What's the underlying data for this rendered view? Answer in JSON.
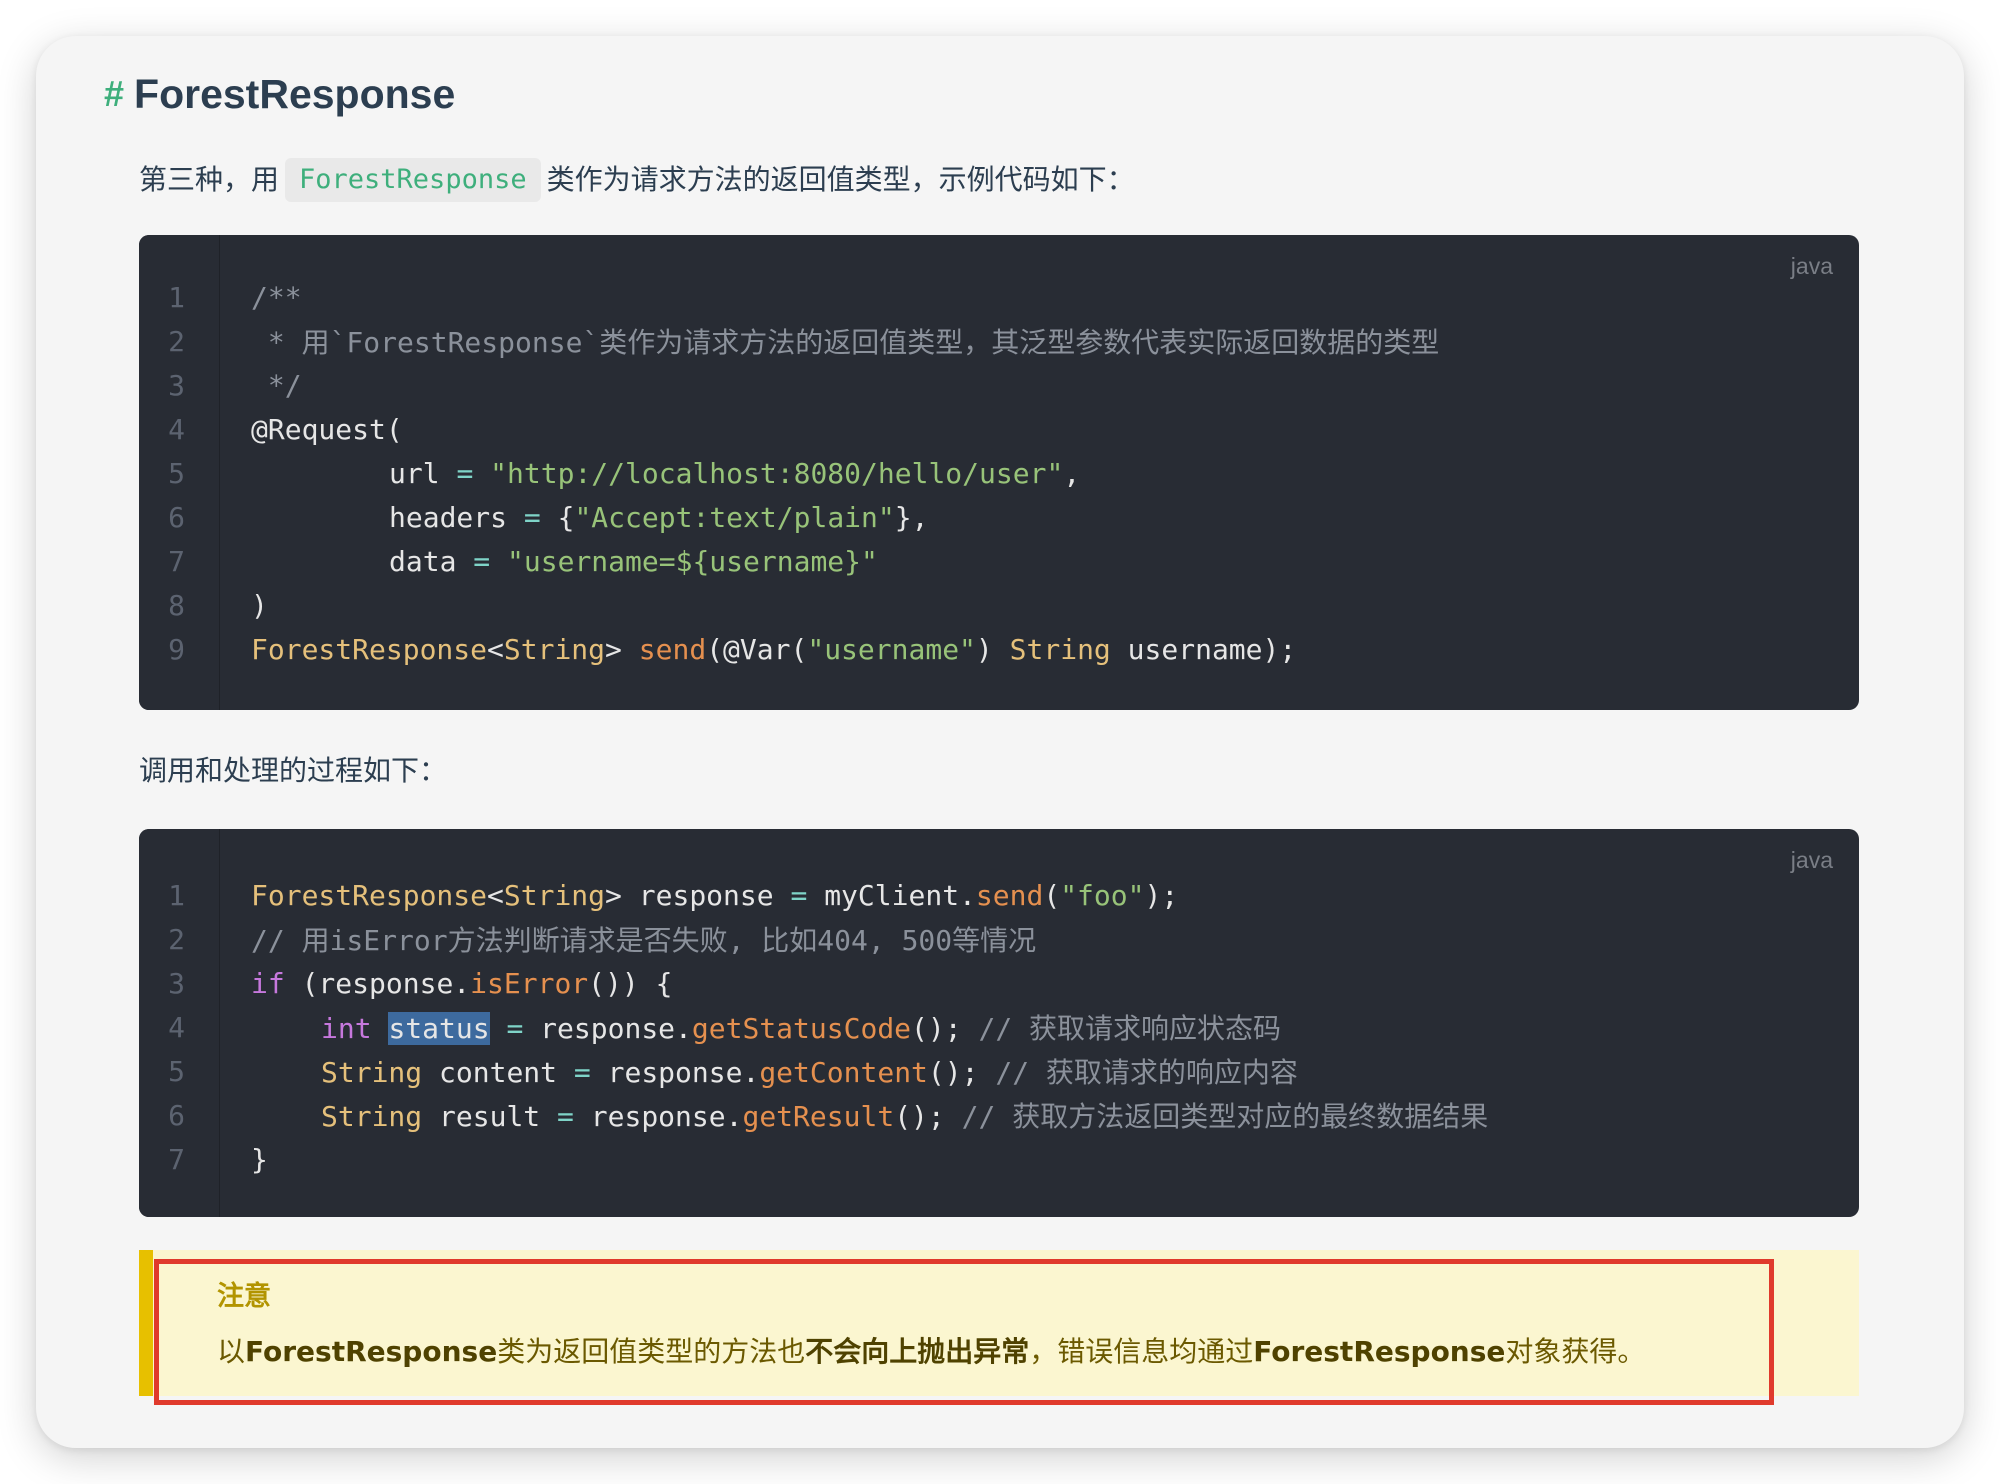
{
  "heading": {
    "hash": "#",
    "title": "ForestResponse"
  },
  "intro": {
    "prefix": "第三种，用",
    "code": "ForestResponse",
    "suffix": "类作为请求方法的返回值类型，示例代码如下："
  },
  "code1": {
    "lang": "java",
    "line_numbers": [
      "1",
      "2",
      "3",
      "4",
      "5",
      "6",
      "7",
      "8",
      "9"
    ],
    "tokens": [
      "/**",
      " * 用`ForestResponse`类作为请求方法的返回值类型，其泛型参数代表实际返回数据的类型",
      " */",
      "@Request(",
      "url",
      "=",
      "\"http://localhost:8080/hello/user\"",
      ",",
      "headers",
      "=",
      "{",
      "\"Accept:text/plain\"",
      "},",
      "data",
      "=",
      "\"username=${username}\"",
      ")",
      "ForestResponse",
      "<",
      "String",
      ">",
      "send",
      "(@Var(",
      "\"username\"",
      ")",
      "String",
      "username);"
    ]
  },
  "middle": {
    "text": "调用和处理的过程如下："
  },
  "code2": {
    "lang": "java",
    "line_numbers": [
      "1",
      "2",
      "3",
      "4",
      "5",
      "6",
      "7"
    ],
    "tokens": [
      "ForestResponse",
      "<",
      "String",
      ">",
      "response",
      "=",
      "myClient.",
      "send",
      "(",
      "\"foo\"",
      ");",
      "// 用isError方法判断请求是否失败, 比如404, 500等情况",
      "if",
      "(response.",
      "isError",
      "()) {",
      "int",
      "status",
      "=",
      "response.",
      "getStatusCode",
      "();",
      "// 获取请求响应状态码",
      "String",
      "content",
      "=",
      "response.",
      "getContent",
      "();",
      "// 获取请求的响应内容",
      "String",
      "result",
      "=",
      "response.",
      "getResult",
      "();",
      "// 获取方法返回类型对应的最终数据结果",
      "}"
    ]
  },
  "notice": {
    "title": "注意",
    "parts": [
      "以",
      "ForestResponse",
      "类为返回值类型的方法也",
      "不会向上抛出异常",
      "，错误信息均通过",
      "ForestResponse",
      "对象获得。"
    ]
  },
  "colors": {
    "accent": "#3eaf7c",
    "code_bg": "#282c34",
    "notice_bg": "#fbf6d0",
    "notice_border": "#e7c000",
    "highlight_box": "#e03a2c"
  }
}
